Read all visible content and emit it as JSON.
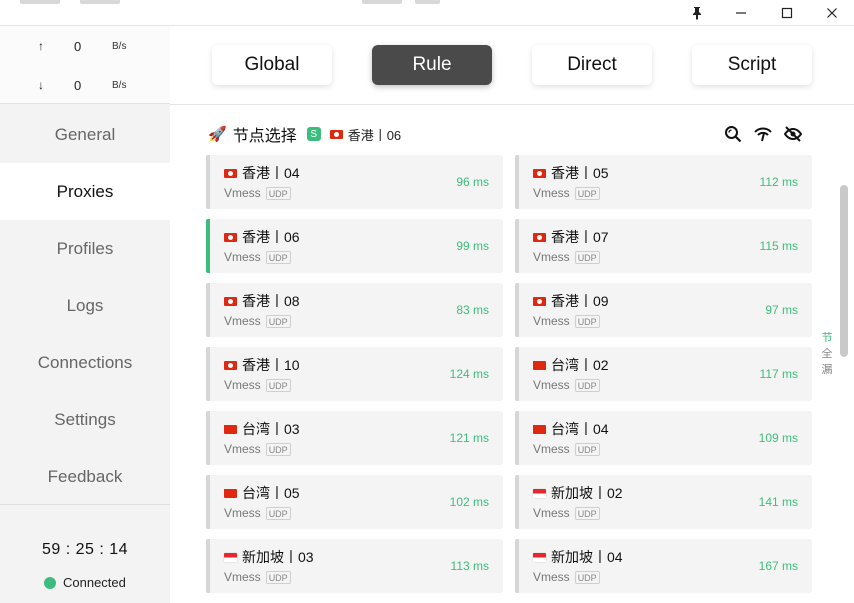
{
  "window": {
    "pin_icon": "pin-icon",
    "minimize_icon": "minimize-icon",
    "maximize_icon": "maximize-icon",
    "close_icon": "close-icon"
  },
  "traffic": {
    "up": {
      "arrow": "↑",
      "value": "0",
      "unit": "B/s"
    },
    "down": {
      "arrow": "↓",
      "value": "0",
      "unit": "B/s"
    }
  },
  "nav": {
    "items": [
      {
        "label": "General"
      },
      {
        "label": "Proxies"
      },
      {
        "label": "Profiles"
      },
      {
        "label": "Logs"
      },
      {
        "label": "Connections"
      },
      {
        "label": "Settings"
      },
      {
        "label": "Feedback"
      }
    ],
    "active": "Proxies"
  },
  "status": {
    "uptime": "59 : 25 : 14",
    "connection": "Connected",
    "connected_color": "#3dbd7d"
  },
  "modes": {
    "items": [
      {
        "label": "Global"
      },
      {
        "label": "Rule"
      },
      {
        "label": "Direct"
      },
      {
        "label": "Script"
      }
    ],
    "active": "Rule"
  },
  "group": {
    "icon": "🚀",
    "title": "节点选择",
    "type_badge": "S",
    "current": "香港丨06",
    "actions": [
      "search-icon",
      "latency-test-icon",
      "hide-icon"
    ]
  },
  "proxies": [
    {
      "name": "香港丨04",
      "flag": "hk",
      "type": "Vmess",
      "udp": "UDP",
      "delay": "96 ms"
    },
    {
      "name": "香港丨05",
      "flag": "hk",
      "type": "Vmess",
      "udp": "UDP",
      "delay": "112 ms"
    },
    {
      "name": "香港丨06",
      "flag": "hk",
      "type": "Vmess",
      "udp": "UDP",
      "delay": "99 ms"
    },
    {
      "name": "香港丨07",
      "flag": "hk",
      "type": "Vmess",
      "udp": "UDP",
      "delay": "115 ms"
    },
    {
      "name": "香港丨08",
      "flag": "hk",
      "type": "Vmess",
      "udp": "UDP",
      "delay": "83 ms"
    },
    {
      "name": "香港丨09",
      "flag": "hk",
      "type": "Vmess",
      "udp": "UDP",
      "delay": "97 ms"
    },
    {
      "name": "香港丨10",
      "flag": "hk",
      "type": "Vmess",
      "udp": "UDP",
      "delay": "124 ms"
    },
    {
      "name": "台湾丨02",
      "flag": "tw",
      "type": "Vmess",
      "udp": "UDP",
      "delay": "117 ms"
    },
    {
      "name": "台湾丨03",
      "flag": "tw",
      "type": "Vmess",
      "udp": "UDP",
      "delay": "121 ms"
    },
    {
      "name": "台湾丨04",
      "flag": "tw",
      "type": "Vmess",
      "udp": "UDP",
      "delay": "109 ms"
    },
    {
      "name": "台湾丨05",
      "flag": "tw",
      "type": "Vmess",
      "udp": "UDP",
      "delay": "102 ms"
    },
    {
      "name": "新加坡丨02",
      "flag": "sg",
      "type": "Vmess",
      "udp": "UDP",
      "delay": "141 ms"
    },
    {
      "name": "新加坡丨03",
      "flag": "sg",
      "type": "Vmess",
      "udp": "UDP",
      "delay": "113 ms"
    },
    {
      "name": "新加坡丨04",
      "flag": "sg",
      "type": "Vmess",
      "udp": "UDP",
      "delay": "167 ms"
    }
  ],
  "selected_proxy": "香港丨06",
  "side_index": [
    "节",
    "全",
    "漏"
  ],
  "colors": {
    "accent": "#3dbd7d",
    "active_mode_bg": "#4a4a4a"
  }
}
